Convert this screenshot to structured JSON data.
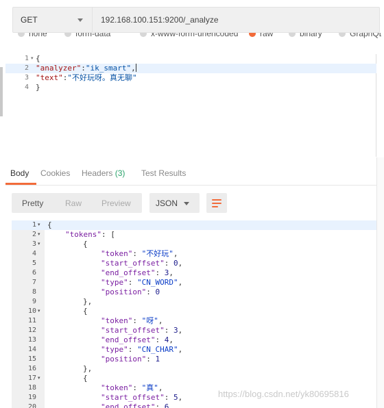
{
  "request": {
    "method": "GET",
    "url": "192.168.100.151:9200/_analyze"
  },
  "body_types": [
    {
      "label": "none",
      "selected": false
    },
    {
      "label": "form-data",
      "selected": false
    },
    {
      "label": "x-www-form-urlencoded",
      "selected": false
    },
    {
      "label": "raw",
      "selected": true
    },
    {
      "label": "binary",
      "selected": false
    },
    {
      "label": "GraphQL",
      "selected": false
    }
  ],
  "request_body": [
    {
      "n": "1",
      "fold": true,
      "parts": [
        [
          "pun",
          "{"
        ]
      ]
    },
    {
      "n": "2",
      "fold": false,
      "active": true,
      "cursor": true,
      "parts": [
        [
          "key",
          "\"analyzer\""
        ],
        [
          "pun",
          ":"
        ],
        [
          "str",
          "\"ik_smart\""
        ],
        [
          "pun",
          ","
        ]
      ]
    },
    {
      "n": "3",
      "fold": false,
      "parts": [
        [
          "key",
          "\"text\""
        ],
        [
          "pun",
          ":"
        ],
        [
          "str",
          "\"不好玩呀。真无聊\""
        ]
      ]
    },
    {
      "n": "4",
      "fold": false,
      "parts": [
        [
          "pun",
          "}"
        ]
      ]
    }
  ],
  "response_tabs": {
    "body": "Body",
    "cookies": "Cookies",
    "headers": "Headers",
    "headers_count": "(3)",
    "test_results": "Test Results"
  },
  "toolbar": {
    "pretty": "Pretty",
    "raw": "Raw",
    "preview": "Preview",
    "format": "JSON"
  },
  "response_body": [
    {
      "n": "1",
      "fold": true,
      "active": true,
      "indent": 0,
      "parts": [
        [
          "pun",
          "{"
        ]
      ]
    },
    {
      "n": "2",
      "fold": true,
      "indent": 1,
      "parts": [
        [
          "key",
          "\"tokens\""
        ],
        [
          "pun",
          ": ["
        ]
      ]
    },
    {
      "n": "3",
      "fold": true,
      "indent": 2,
      "parts": [
        [
          "pun",
          "{"
        ]
      ]
    },
    {
      "n": "4",
      "fold": false,
      "indent": 3,
      "parts": [
        [
          "key",
          "\"token\""
        ],
        [
          "pun",
          ": "
        ],
        [
          "str",
          "\"不好玩\""
        ],
        [
          "pun",
          ","
        ]
      ]
    },
    {
      "n": "5",
      "fold": false,
      "indent": 3,
      "parts": [
        [
          "key",
          "\"start_offset\""
        ],
        [
          "pun",
          ": "
        ],
        [
          "num",
          "0"
        ],
        [
          "pun",
          ","
        ]
      ]
    },
    {
      "n": "6",
      "fold": false,
      "indent": 3,
      "parts": [
        [
          "key",
          "\"end_offset\""
        ],
        [
          "pun",
          ": "
        ],
        [
          "num",
          "3"
        ],
        [
          "pun",
          ","
        ]
      ]
    },
    {
      "n": "7",
      "fold": false,
      "indent": 3,
      "parts": [
        [
          "key",
          "\"type\""
        ],
        [
          "pun",
          ": "
        ],
        [
          "str",
          "\"CN_WORD\""
        ],
        [
          "pun",
          ","
        ]
      ]
    },
    {
      "n": "8",
      "fold": false,
      "indent": 3,
      "parts": [
        [
          "key",
          "\"position\""
        ],
        [
          "pun",
          ": "
        ],
        [
          "num",
          "0"
        ]
      ]
    },
    {
      "n": "9",
      "fold": false,
      "indent": 2,
      "parts": [
        [
          "pun",
          "},"
        ]
      ]
    },
    {
      "n": "10",
      "fold": true,
      "indent": 2,
      "parts": [
        [
          "pun",
          "{"
        ]
      ]
    },
    {
      "n": "11",
      "fold": false,
      "indent": 3,
      "parts": [
        [
          "key",
          "\"token\""
        ],
        [
          "pun",
          ": "
        ],
        [
          "str",
          "\"呀\""
        ],
        [
          "pun",
          ","
        ]
      ]
    },
    {
      "n": "12",
      "fold": false,
      "indent": 3,
      "parts": [
        [
          "key",
          "\"start_offset\""
        ],
        [
          "pun",
          ": "
        ],
        [
          "num",
          "3"
        ],
        [
          "pun",
          ","
        ]
      ]
    },
    {
      "n": "13",
      "fold": false,
      "indent": 3,
      "parts": [
        [
          "key",
          "\"end_offset\""
        ],
        [
          "pun",
          ": "
        ],
        [
          "num",
          "4"
        ],
        [
          "pun",
          ","
        ]
      ]
    },
    {
      "n": "14",
      "fold": false,
      "indent": 3,
      "parts": [
        [
          "key",
          "\"type\""
        ],
        [
          "pun",
          ": "
        ],
        [
          "str",
          "\"CN_CHAR\""
        ],
        [
          "pun",
          ","
        ]
      ]
    },
    {
      "n": "15",
      "fold": false,
      "indent": 3,
      "parts": [
        [
          "key",
          "\"position\""
        ],
        [
          "pun",
          ": "
        ],
        [
          "num",
          "1"
        ]
      ]
    },
    {
      "n": "16",
      "fold": false,
      "indent": 2,
      "parts": [
        [
          "pun",
          "},"
        ]
      ]
    },
    {
      "n": "17",
      "fold": true,
      "indent": 2,
      "parts": [
        [
          "pun",
          "{"
        ]
      ]
    },
    {
      "n": "18",
      "fold": false,
      "indent": 3,
      "parts": [
        [
          "key",
          "\"token\""
        ],
        [
          "pun",
          ": "
        ],
        [
          "str",
          "\"真\""
        ],
        [
          "pun",
          ","
        ]
      ]
    },
    {
      "n": "19",
      "fold": false,
      "indent": 3,
      "parts": [
        [
          "key",
          "\"start_offset\""
        ],
        [
          "pun",
          ": "
        ],
        [
          "num",
          "5"
        ],
        [
          "pun",
          ","
        ]
      ]
    },
    {
      "n": "20",
      "fold": false,
      "indent": 3,
      "parts": [
        [
          "key",
          "\"end_offset\""
        ],
        [
          "pun",
          ": "
        ],
        [
          "num",
          "6"
        ]
      ]
    }
  ],
  "watermark": "https://blog.csdn.net/yk80695816",
  "colors": {
    "accent": "#f26b3a",
    "headers_count": "#2aa36b",
    "active_line": "#e8f2fe"
  }
}
